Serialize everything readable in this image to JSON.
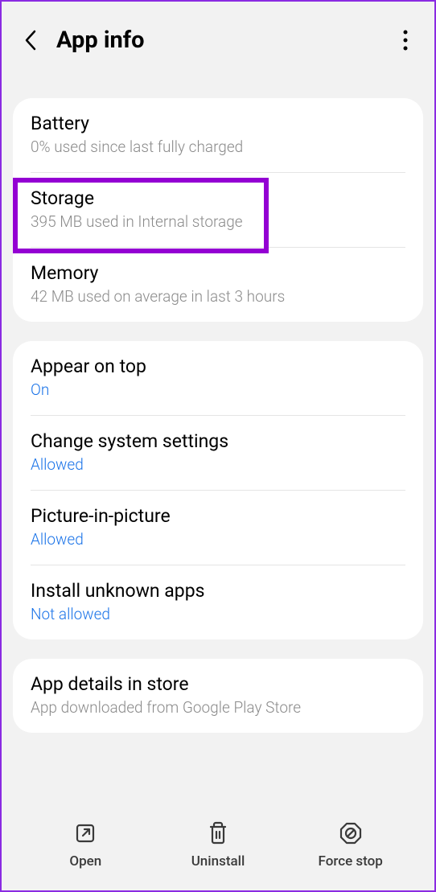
{
  "header": {
    "title": "App info"
  },
  "card1": {
    "battery": {
      "title": "Battery",
      "sub": "0% used since last fully charged"
    },
    "storage": {
      "title": "Storage",
      "sub": "395 MB used in Internal storage"
    },
    "memory": {
      "title": "Memory",
      "sub": "42 MB used on average in last 3 hours"
    }
  },
  "card2": {
    "appearOnTop": {
      "title": "Appear on top",
      "sub": "On"
    },
    "changeSystem": {
      "title": "Change system settings",
      "sub": "Allowed"
    },
    "pip": {
      "title": "Picture-in-picture",
      "sub": "Allowed"
    },
    "installUnknown": {
      "title": "Install unknown apps",
      "sub": "Not allowed"
    }
  },
  "card3": {
    "appDetails": {
      "title": "App details in store",
      "sub": "App downloaded from Google Play Store"
    }
  },
  "bottomNav": {
    "open": "Open",
    "uninstall": "Uninstall",
    "forceStop": "Force stop"
  }
}
